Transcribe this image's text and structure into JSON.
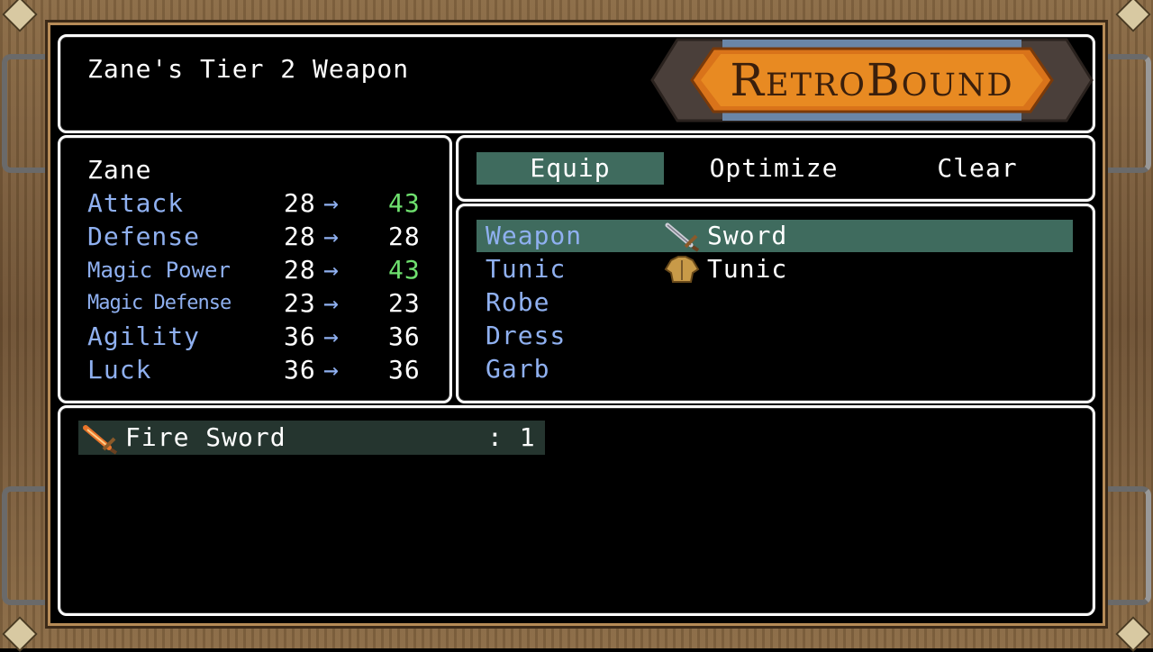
{
  "help": {
    "text": "Zane's Tier 2 Weapon"
  },
  "logo": {
    "text": "RetroBound"
  },
  "status": {
    "actor_name": "Zane",
    "arrow": "→",
    "params": [
      {
        "label": "Attack",
        "current": "28",
        "new": "43",
        "change": "up"
      },
      {
        "label": "Defense",
        "current": "28",
        "new": "28",
        "change": "same"
      },
      {
        "label": "Magic Power",
        "current": "28",
        "new": "43",
        "change": "up"
      },
      {
        "label": "Magic Defense",
        "current": "23",
        "new": "23",
        "change": "same"
      },
      {
        "label": "Agility",
        "current": "36",
        "new": "36",
        "change": "same"
      },
      {
        "label": "Luck",
        "current": "36",
        "new": "36",
        "change": "same"
      }
    ]
  },
  "commands": {
    "items": [
      {
        "label": "Equip",
        "selected": true
      },
      {
        "label": "Optimize",
        "selected": false
      },
      {
        "label": "Clear",
        "selected": false
      }
    ]
  },
  "slots": {
    "items": [
      {
        "slot": "Weapon",
        "equipped": "Sword",
        "icon": "sword-icon",
        "selected": true
      },
      {
        "slot": "Tunic",
        "equipped": "Tunic",
        "icon": "tunic-icon",
        "selected": false
      },
      {
        "slot": "Robe",
        "equipped": "",
        "icon": "",
        "selected": false
      },
      {
        "slot": "Dress",
        "equipped": "",
        "icon": "",
        "selected": false
      },
      {
        "slot": "Garb",
        "equipped": "",
        "icon": "",
        "selected": false
      }
    ]
  },
  "item_list": {
    "items": [
      {
        "name": "Fire Sword",
        "count": ": 1",
        "icon": "fire-sword-icon"
      }
    ]
  },
  "colors": {
    "system_text": "#8fb0f0",
    "power_up": "#6ee06e",
    "cursor": "#3f6b5e",
    "window_border": "#ffffff"
  }
}
